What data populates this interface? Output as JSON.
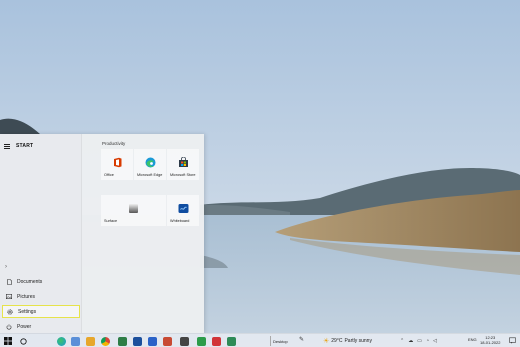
{
  "start_menu": {
    "title": "START",
    "nav": {
      "documents": "Documents",
      "pictures": "Pictures",
      "settings": "Settings",
      "power": "Power"
    },
    "group_label": "Productivity",
    "tiles": {
      "office": "Office",
      "edge": "Microsoft Edge",
      "store": "Microsoft Store",
      "surface": "Surface",
      "whiteboard": "Whiteboard"
    }
  },
  "taskbar": {
    "desktop_label": "Desktop",
    "weather": {
      "temperature": "29°C",
      "condition": "Partly sunny"
    },
    "language": "ENG",
    "time": "12:23",
    "date": "18-01-2022"
  },
  "colors": {
    "active_highlight": "#e6e34a",
    "taskbar_indicator": "#2b6fd6"
  },
  "icons": [
    "hamburger-icon",
    "chevron-icon",
    "document-icon",
    "pictures-icon",
    "gear-icon",
    "power-icon",
    "windows-icon",
    "search-icon",
    "pen-icon",
    "weather-icon",
    "notification-icon"
  ]
}
